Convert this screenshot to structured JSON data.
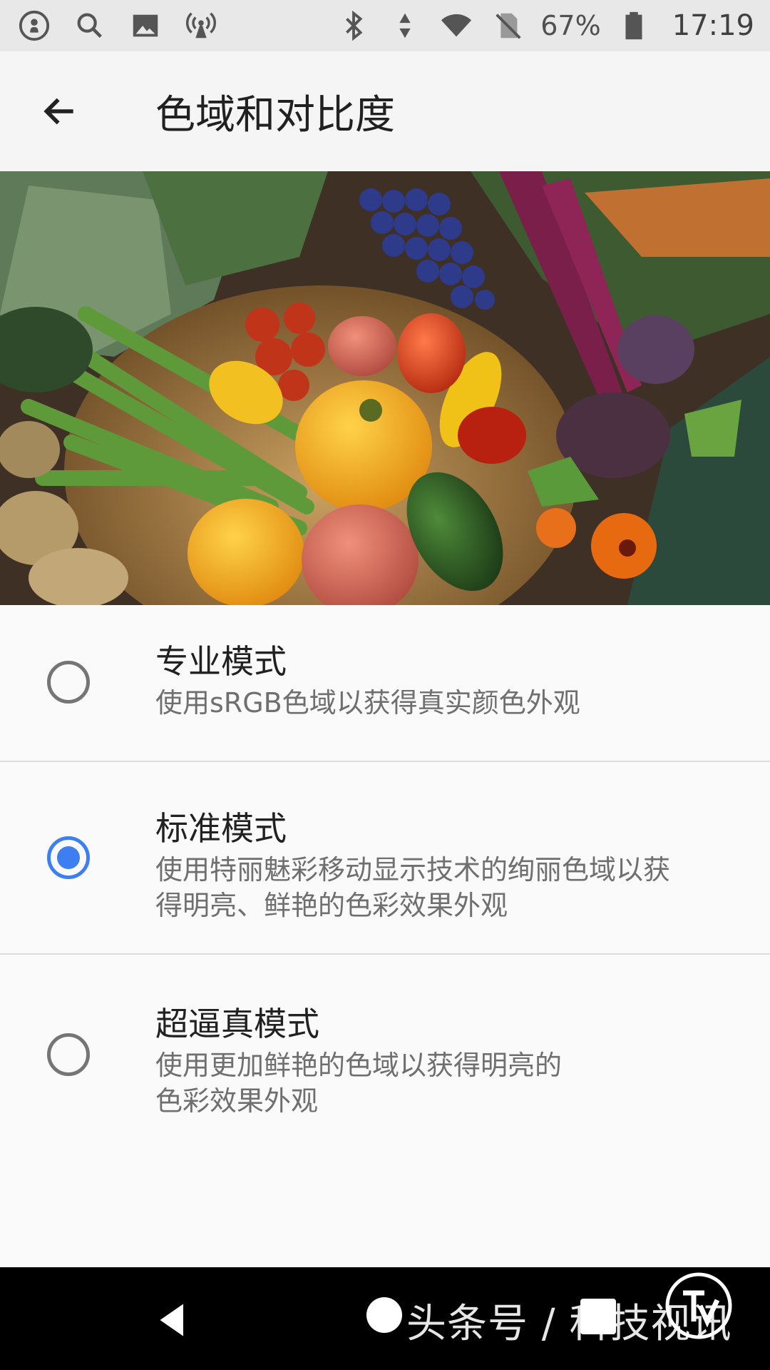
{
  "status_bar": {
    "battery_percent": "67%",
    "time": "17:19",
    "icons_left": [
      "account-icon",
      "search-icon",
      "image-icon",
      "broadcast-icon"
    ],
    "icons_right": [
      "bluetooth-icon",
      "data-arrows-icon",
      "wifi-icon",
      "no-sim-icon",
      "battery-icon"
    ]
  },
  "app_bar": {
    "title": "色域和对比度"
  },
  "options": [
    {
      "title": "专业模式",
      "description": "使用sRGB色域以获得真实颜色外观",
      "selected": false
    },
    {
      "title": "标准模式",
      "description": "使用特丽魅彩移动显示技术的绚丽色域以获\n得明亮、鲜艳的色彩效果外观",
      "selected": true
    },
    {
      "title": "超逼真模式",
      "description": "使用更加鲜艳的色域以获得明亮的\n色彩效果外观",
      "selected": false
    }
  ],
  "watermark": {
    "text": "头条号 / 科技视讯"
  },
  "colors": {
    "accent": "#3d7ff0",
    "status_bar_bg": "#e8e8e8",
    "app_bar_bg": "#f5f5f5",
    "nav_bar_bg": "#000000"
  }
}
